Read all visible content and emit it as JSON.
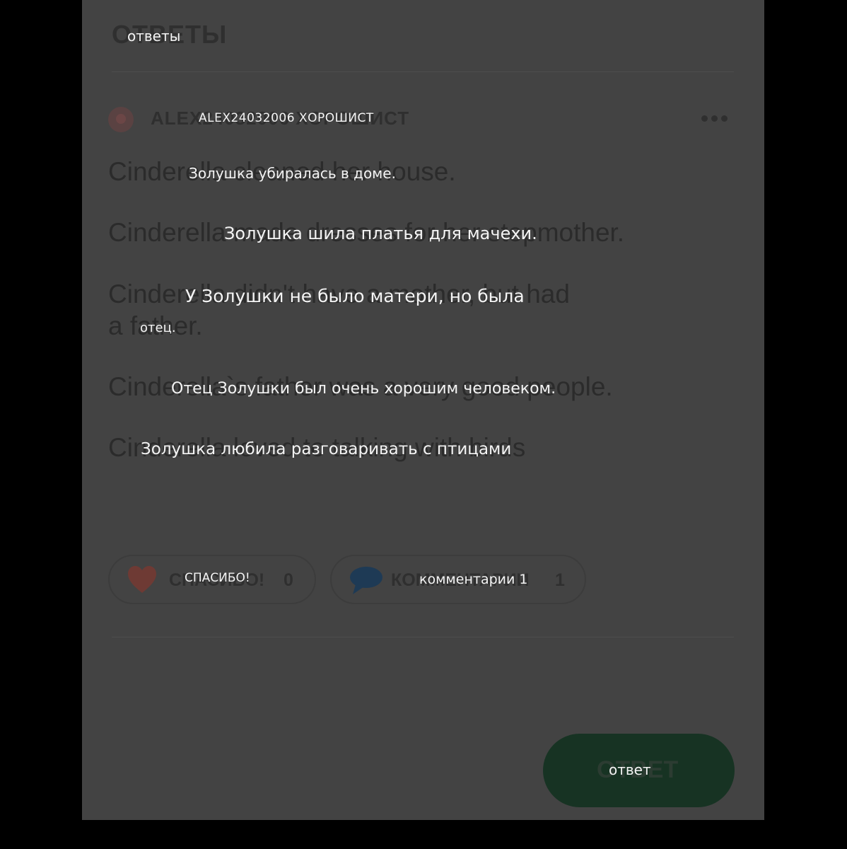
{
  "original": {
    "header": {
      "title": "ОТВЕТЫ"
    },
    "answer": {
      "author": "ALEX24032006 ХОРОШИСТ",
      "lines": [
        "Cinderella cleaned her house.",
        "Cinderella made dresses for her stepmother.",
        "Cinderella didn't have a mother, but had",
        "a father.",
        "Cinderella`s father was a very good people.",
        "Cinderella loved to talking with birds"
      ]
    },
    "actions": {
      "thanks_label": "СПАСИБО!",
      "thanks_count": "0",
      "comments_label": "КОММЕНТАРИИ",
      "comments_count": "1"
    },
    "answer_button": "ОТВЕТ"
  },
  "overlay": {
    "header_title": "ответы",
    "author": "ALEX24032006 ХОРОШИСТ",
    "lines": [
      "Золушка убиралась в доме.",
      "Золушка шила платья для мачехи.",
      "У Золушки не было матери, но была",
      "отец.",
      "Отец Золушки был очень хорошим человеком.",
      "Золушка любила разговаривать с птицами"
    ],
    "thanks": "СПАСИБО!",
    "comments": "комментарии 1",
    "answer_button": "ответ"
  },
  "colors": {
    "background": "#000000",
    "panel": "#434343",
    "heart": "#6e3a34",
    "bubble": "#1e3a55",
    "answer_button": "#173323"
  },
  "icons": [
    "avatar",
    "more-dots-icon",
    "heart-icon",
    "comment-bubble-icon"
  ]
}
